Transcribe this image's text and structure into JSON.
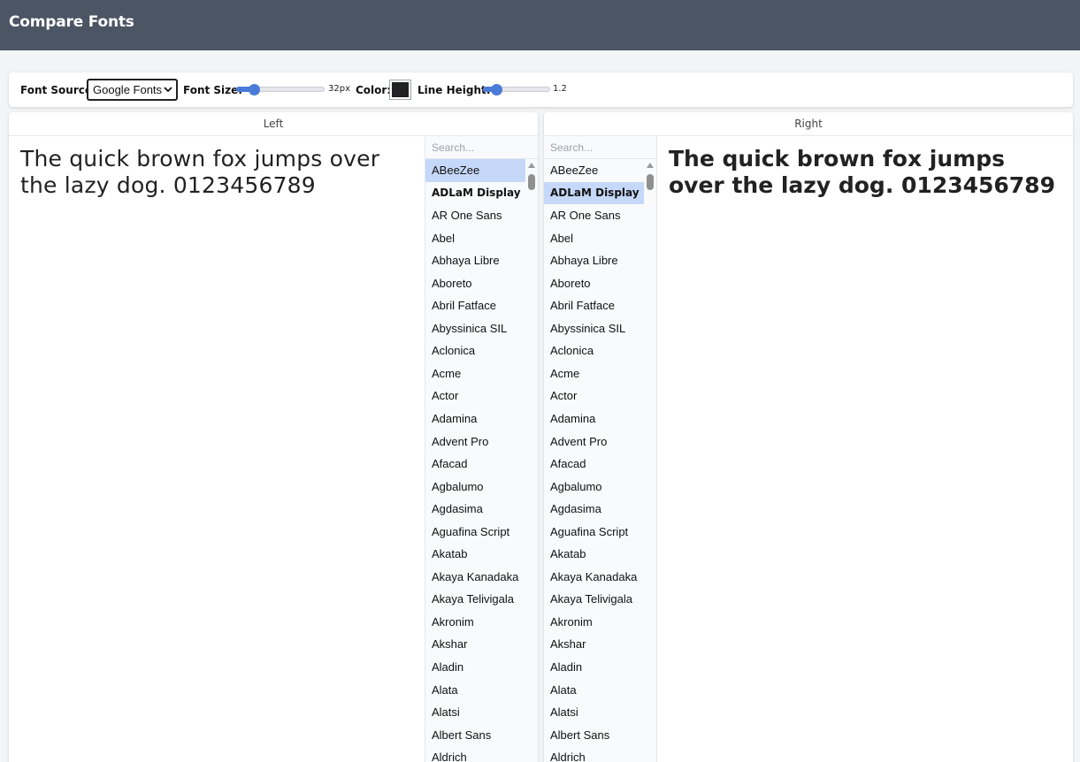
{
  "header": {
    "title": "Compare Fonts"
  },
  "toolbar": {
    "font_source_label": "Font Source:",
    "font_source_value": "Google Fonts",
    "font_size_label": "Font Size:",
    "font_size_value": "32px",
    "font_size_level": 0.2,
    "color_label": "Color:",
    "color_value": "#222222",
    "line_height_label": "Line Height:",
    "line_height_value": "1.2",
    "line_height_level": 0.2
  },
  "left_panel": {
    "header": "Left",
    "preview_text": "The quick brown fox jumps over the lazy dog. 0123456789",
    "search_placeholder": "Search...",
    "selected_font": "ABeeZee"
  },
  "right_panel": {
    "header": "Right",
    "preview_text": "The quick brown fox jumps over the lazy dog. 0123456789",
    "search_placeholder": "Search...",
    "selected_font": "ADLaM Display"
  },
  "fonts": [
    "ABeeZee",
    "ADLaM Display",
    "AR One Sans",
    "Abel",
    "Abhaya Libre",
    "Aboreto",
    "Abril Fatface",
    "Abyssinica SIL",
    "Aclonica",
    "Acme",
    "Actor",
    "Adamina",
    "Advent Pro",
    "Afacad",
    "Agbalumo",
    "Agdasima",
    "Aguafina Script",
    "Akatab",
    "Akaya Kanadaka",
    "Akaya Telivigala",
    "Akronim",
    "Akshar",
    "Aladin",
    "Alata",
    "Alatsi",
    "Albert Sans",
    "Aldrich"
  ]
}
